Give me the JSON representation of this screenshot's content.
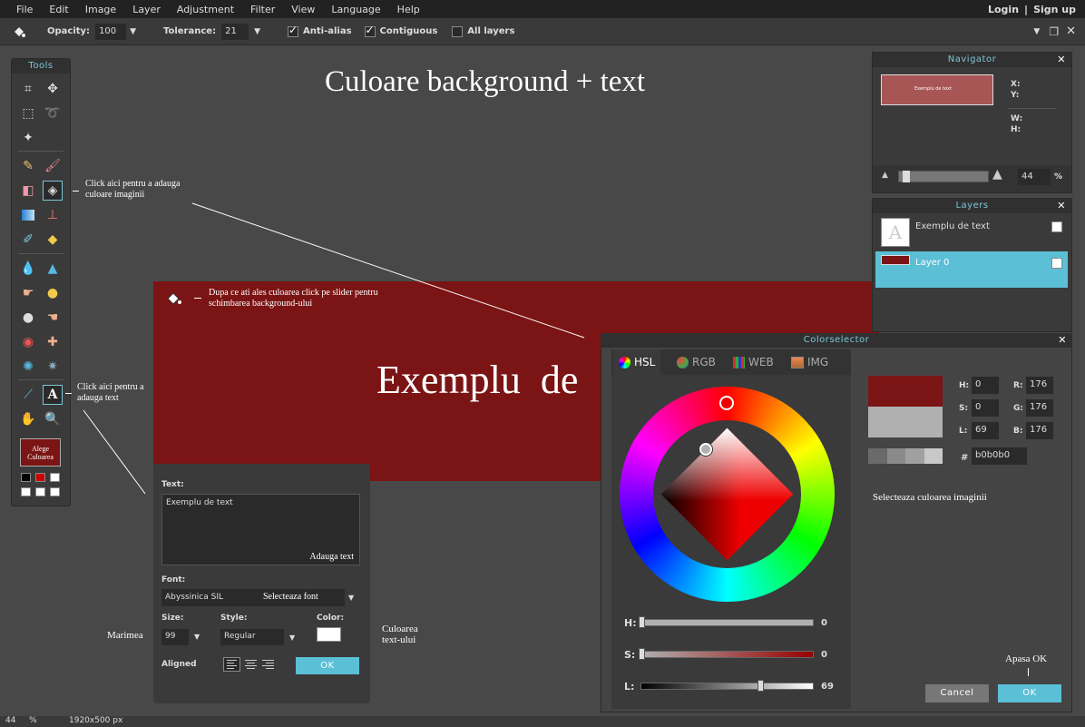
{
  "menu": {
    "items": [
      "File",
      "Edit",
      "Image",
      "Layer",
      "Adjustment",
      "Filter",
      "View",
      "Language",
      "Help"
    ],
    "login": "Login",
    "separator": "|",
    "signup": "Sign up"
  },
  "toolbar": {
    "opacity_label": "Opacity:",
    "opacity_value": "100",
    "tolerance_label": "Tolerance:",
    "tolerance_value": "21",
    "antialias_label": "Anti-alias",
    "contiguous_label": "Contiguous",
    "alllayers_label": "All layers"
  },
  "canvas": {
    "heading": "Culoare background + text",
    "banner_color": "#7b1414",
    "banner_text": "Exemplu  de"
  },
  "tools_panel": {
    "title": "Tools",
    "color_button_label": "Alege Culoarea",
    "swatches": [
      "#000000",
      "#cc0000",
      "#ffffff",
      "#ffffff",
      "#ffffff",
      "#ffffff"
    ]
  },
  "annotations": {
    "fill_tool": "Click aici pentru a adauga culoare imaginii",
    "slider_hint": "Dupa ce ati ales culoarea click pe slider pentru schimbarea background-ului",
    "text_tool": "Click aici pentru a adauga text",
    "size_note": "Marimea",
    "color_note": "Culoarea text-ului",
    "select_color": "Selecteaza culoarea imaginii",
    "press_ok": "Apasa OK"
  },
  "text_dialog": {
    "text_label": "Text:",
    "text_value": "Exemplu de text",
    "add_text_hint": "Adauga text",
    "font_label": "Font:",
    "font_value": "Abyssinica SIL",
    "font_hint": "Selecteaza font",
    "size_label": "Size:",
    "size_value": "99",
    "style_label": "Style:",
    "style_value": "Regular",
    "color_label": "Color:",
    "aligned_label": "Aligned",
    "ok": "OK"
  },
  "navigator": {
    "title": "Navigator",
    "preview_text": "Exemplu de text",
    "x_label": "X:",
    "y_label": "Y:",
    "w_label": "W:",
    "h_label": "H:",
    "zoom_value": "44",
    "zoom_unit": "%",
    "zoom_fraction": 0.05
  },
  "layers": {
    "title": "Layers",
    "items": [
      {
        "name": "Exemplu de text",
        "selected": false
      },
      {
        "name": "Layer 0",
        "selected": true
      }
    ]
  },
  "colorselector": {
    "title": "Colorselector",
    "tabs": [
      "HSL",
      "RGB",
      "WEB",
      "IMG"
    ],
    "h_label": "H:",
    "h_value": "0",
    "s_label": "S:",
    "s_value": "0",
    "l_label": "L:",
    "l_value": "69",
    "r_label": "R:",
    "r_value": "176",
    "g_label": "G:",
    "g_value": "176",
    "b_label": "B:",
    "b_value": "176",
    "hash": "#",
    "hex_value": "b0b0b0",
    "old_color": "#7b1414",
    "new_color": "#b0b0b0",
    "slider_h_label": "H:",
    "slider_h_value": "0",
    "slider_s_label": "S:",
    "slider_s_value": "0",
    "slider_l_label": "L:",
    "slider_l_value": "69",
    "l_fraction": 0.69,
    "cancel": "Cancel",
    "ok": "OK"
  },
  "statusbar": {
    "zoom": "44",
    "unit": "%",
    "dimensions": "1920x500 px"
  }
}
